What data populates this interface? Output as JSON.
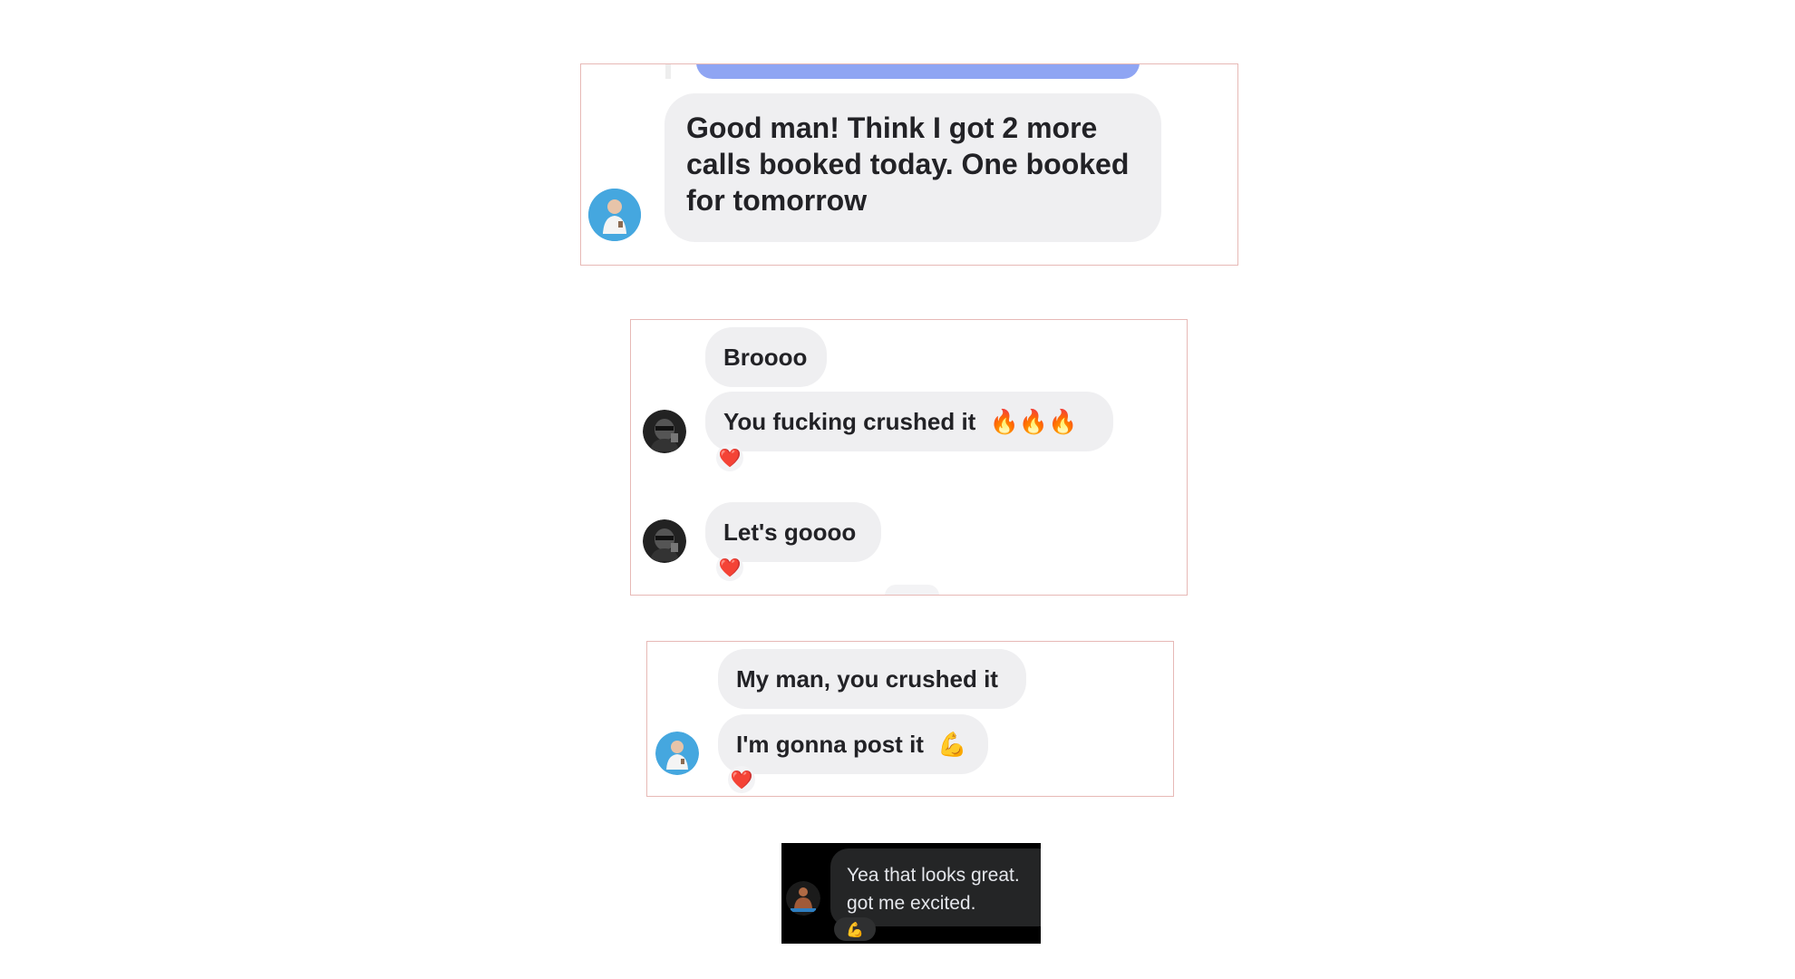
{
  "colors": {
    "card_border": "#e7b9b6",
    "bubble_bg": "#efeff1",
    "sent_bubble": "#8fa5f3",
    "dark_card_bg": "#000000",
    "dark_bubble_bg": "#242526",
    "heart": "#e8392f",
    "fire": "#f5861f"
  },
  "conversations": [
    {
      "messages": [
        {
          "text": "Good man! Think I got 2 more calls booked today. One booked for tomorrow",
          "avatar": "blue-avatar"
        }
      ]
    },
    {
      "messages": [
        {
          "text": "Broooo"
        },
        {
          "text": "You fucking crushed it",
          "emoji": "🔥🔥🔥",
          "reaction": "❤️",
          "avatar": "dark-avatar"
        },
        {
          "text": "Let's goooo",
          "reaction": "❤️",
          "avatar": "dark-avatar"
        }
      ]
    },
    {
      "messages": [
        {
          "text": "My man, you crushed it"
        },
        {
          "text": "I'm gonna post it",
          "emoji": "💪",
          "reaction": "❤️",
          "avatar": "blue-avatar"
        }
      ]
    },
    {
      "theme": "dark",
      "messages": [
        {
          "text_lines": [
            "Yea that looks great.",
            "got me excited."
          ],
          "reaction": "💪",
          "avatar": "fitness-avatar"
        }
      ]
    }
  ]
}
